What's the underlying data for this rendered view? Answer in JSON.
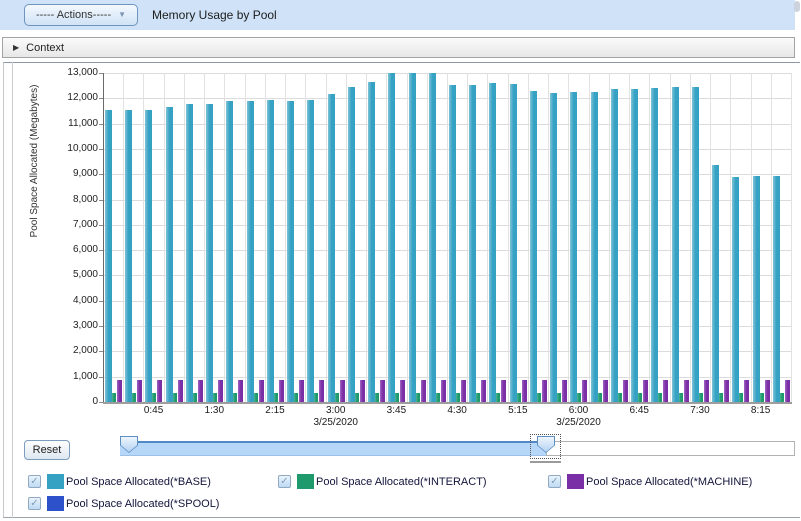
{
  "header": {
    "actions_button": "----- Actions-----",
    "title": "Memory Usage by Pool"
  },
  "icons": {
    "dropdown_caret": "▼",
    "context_caret": "▶",
    "checkmark": "✓"
  },
  "context_bar": {
    "label": "Context"
  },
  "controls": {
    "reset_button": "Reset"
  },
  "chart_data": {
    "type": "bar",
    "title": "Memory Usage by Pool",
    "xlabel": "",
    "ylabel": "Pool Space Allocated (Megabytes)",
    "ylim": [
      0,
      13000
    ],
    "ytick_step": 1000,
    "ytick_labels": [
      "0",
      "1,000",
      "2,000",
      "3,000",
      "4,000",
      "5,000",
      "6,000",
      "7,000",
      "8,000",
      "9,000",
      "10,000",
      "11,000",
      "12,000",
      "13,000"
    ],
    "grid": true,
    "legend_position": "bottom",
    "categories": [
      "0:15",
      "0:30",
      "0:45",
      "1:00",
      "1:15",
      "1:30",
      "1:45",
      "2:00",
      "2:15",
      "2:30",
      "2:45",
      "3:00",
      "3:15",
      "3:30",
      "3:45",
      "4:00",
      "4:15",
      "4:30",
      "4:45",
      "5:00",
      "5:15",
      "5:30",
      "5:45",
      "6:00",
      "6:15",
      "6:30",
      "6:45",
      "7:00",
      "7:15",
      "7:30",
      "7:45",
      "8:00",
      "8:15",
      "8:30"
    ],
    "x_labels": [
      {
        "index": 2,
        "label": "0:45"
      },
      {
        "index": 5,
        "label": "1:30"
      },
      {
        "index": 8,
        "label": "2:15"
      },
      {
        "index": 11,
        "label": "3:00",
        "date": "3/25/2020"
      },
      {
        "index": 14,
        "label": "3:45"
      },
      {
        "index": 17,
        "label": "4:30"
      },
      {
        "index": 20,
        "label": "5:15"
      },
      {
        "index": 23,
        "label": "6:00",
        "date": "3/25/2020"
      },
      {
        "index": 26,
        "label": "6:45"
      },
      {
        "index": 29,
        "label": "7:30"
      },
      {
        "index": 32,
        "label": "8:15"
      }
    ],
    "series": [
      {
        "name": "Pool Space Allocated(*BASE)",
        "color": "#36a2c3",
        "values": [
          11540,
          11540,
          11540,
          11660,
          11780,
          11770,
          11900,
          11880,
          11920,
          11900,
          11920,
          12170,
          12450,
          12650,
          12990,
          13000,
          13000,
          12520,
          12520,
          12600,
          12580,
          12290,
          12200,
          12230,
          12250,
          12370,
          12380,
          12420,
          12430,
          12430,
          9370,
          8890,
          8920,
          8940
        ]
      },
      {
        "name": "Pool Space Allocated(*INTERACT)",
        "color": "#1f9a6d",
        "values": [
          340,
          340,
          340,
          340,
          340,
          340,
          340,
          340,
          340,
          340,
          340,
          340,
          340,
          340,
          340,
          340,
          340,
          340,
          340,
          340,
          340,
          340,
          340,
          340,
          340,
          340,
          340,
          340,
          340,
          340,
          340,
          340,
          340,
          340
        ]
      },
      {
        "name": "Pool Space Allocated(*MACHINE)",
        "color": "#7b2fa7",
        "values": [
          860,
          860,
          860,
          860,
          860,
          860,
          860,
          860,
          860,
          860,
          860,
          860,
          860,
          860,
          860,
          860,
          860,
          860,
          860,
          860,
          860,
          860,
          860,
          860,
          860,
          860,
          860,
          860,
          860,
          860,
          860,
          860,
          860,
          860
        ]
      },
      {
        "name": "Pool Space Allocated(*SPOOL)",
        "color": "#2d50cb",
        "values": [
          0,
          0,
          0,
          0,
          0,
          0,
          0,
          0,
          0,
          0,
          0,
          0,
          0,
          0,
          0,
          0,
          0,
          0,
          0,
          0,
          0,
          0,
          0,
          0,
          0,
          0,
          0,
          0,
          0,
          0,
          0,
          0,
          0,
          0
        ]
      }
    ]
  },
  "legend": {
    "items": [
      {
        "label": "Pool Space Allocated(*BASE)",
        "color": "#36a2c3",
        "checked": true
      },
      {
        "label": "Pool Space Allocated(*INTERACT)",
        "color": "#1f9a6d",
        "checked": true
      },
      {
        "label": "Pool Space Allocated(*MACHINE)",
        "color": "#7b2fa7",
        "checked": true
      },
      {
        "label": "Pool Space Allocated(*SPOOL)",
        "color": "#2d50cb",
        "checked": true
      }
    ]
  }
}
